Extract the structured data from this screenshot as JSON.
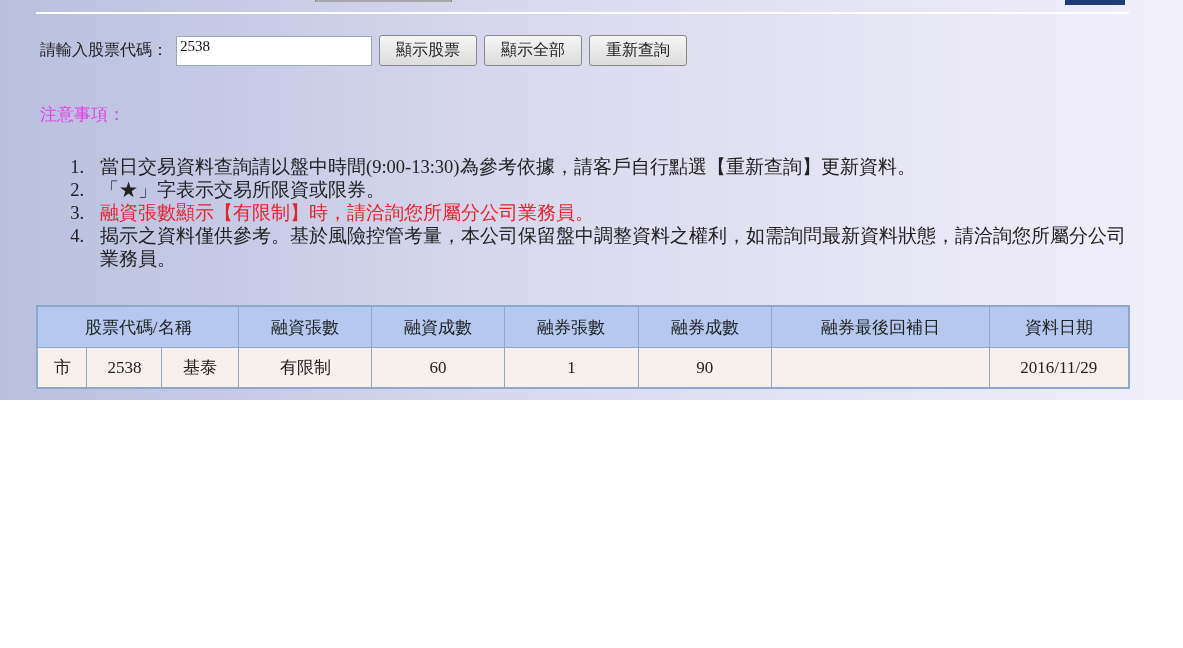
{
  "search": {
    "label": "請輸入股票代碼：",
    "value": "2538",
    "buttons": [
      "顯示股票",
      "顯示全部",
      "重新查詢"
    ]
  },
  "notice": {
    "title": "注意事項：",
    "items": [
      {
        "number": "1.",
        "text": "當日交易資料查詢請以盤中時間(9:00-13:30)為參考依據，請客戶自行點選【重新查詢】更新資料。",
        "kind": "normal"
      },
      {
        "number": "2.",
        "text": "「★」字表示交易所限資或限券。",
        "kind": "normal"
      },
      {
        "number": "3.",
        "text": "融資張數顯示【有限制】時，請洽詢您所屬分公司業務員。",
        "kind": "warning"
      },
      {
        "number": "4.",
        "text": "揭示之資料僅供參考。基於風險控管考量，本公司保留盤中調整資料之權利，如需詢問最新資料狀態，請洽詢您所屬分公司業務員。",
        "kind": "normal"
      }
    ]
  },
  "table": {
    "columns": [
      {
        "label": "股票代碼/名稱",
        "colspan": 3
      },
      {
        "label": "融資張數"
      },
      {
        "label": "融資成數"
      },
      {
        "label": "融券張數"
      },
      {
        "label": "融券成數"
      },
      {
        "label": "融券最後回補日"
      },
      {
        "label": "資料日期"
      }
    ],
    "rows": [
      [
        "市",
        "2538",
        "基泰",
        "有限制",
        "60",
        "1",
        "90",
        "",
        "2016/11/29"
      ]
    ]
  }
}
